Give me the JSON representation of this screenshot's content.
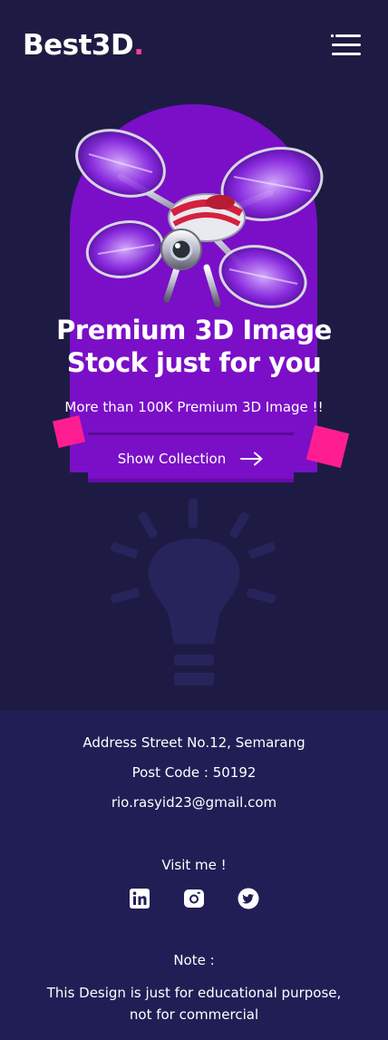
{
  "header": {
    "logo_text": "Best3D",
    "logo_dot": ".",
    "menu_icon": "hamburger-menu-icon"
  },
  "hero": {
    "title_line1": "Premium 3D Image",
    "title_line2": "Stock just for you",
    "subtitle": "More than 100K Premium 3D Image !!",
    "cta_label": "Show Collection",
    "cta_icon": "arrow-right-icon",
    "image_subject": "drone",
    "background_icon": "lightbulb-icon"
  },
  "footer": {
    "address": "Address Street No.12, Semarang",
    "post_code": "Post Code : 50192",
    "email": "rio.rasyid23@gmail.com",
    "visit_label": "Visit me !",
    "social": [
      {
        "name": "linkedin",
        "icon": "linkedin-icon"
      },
      {
        "name": "instagram",
        "icon": "instagram-icon"
      },
      {
        "name": "twitter",
        "icon": "twitter-icon"
      }
    ],
    "note_label": "Note :",
    "note_line1": "This Design is just for educational purpose,",
    "note_line2": "not for commercial"
  },
  "colors": {
    "background": "#1d1b44",
    "footer_background": "#211e56",
    "accent_purple": "#7a0fc7",
    "accent_pink": "#ff1e92",
    "logo_dot": "#ff3d9a"
  }
}
